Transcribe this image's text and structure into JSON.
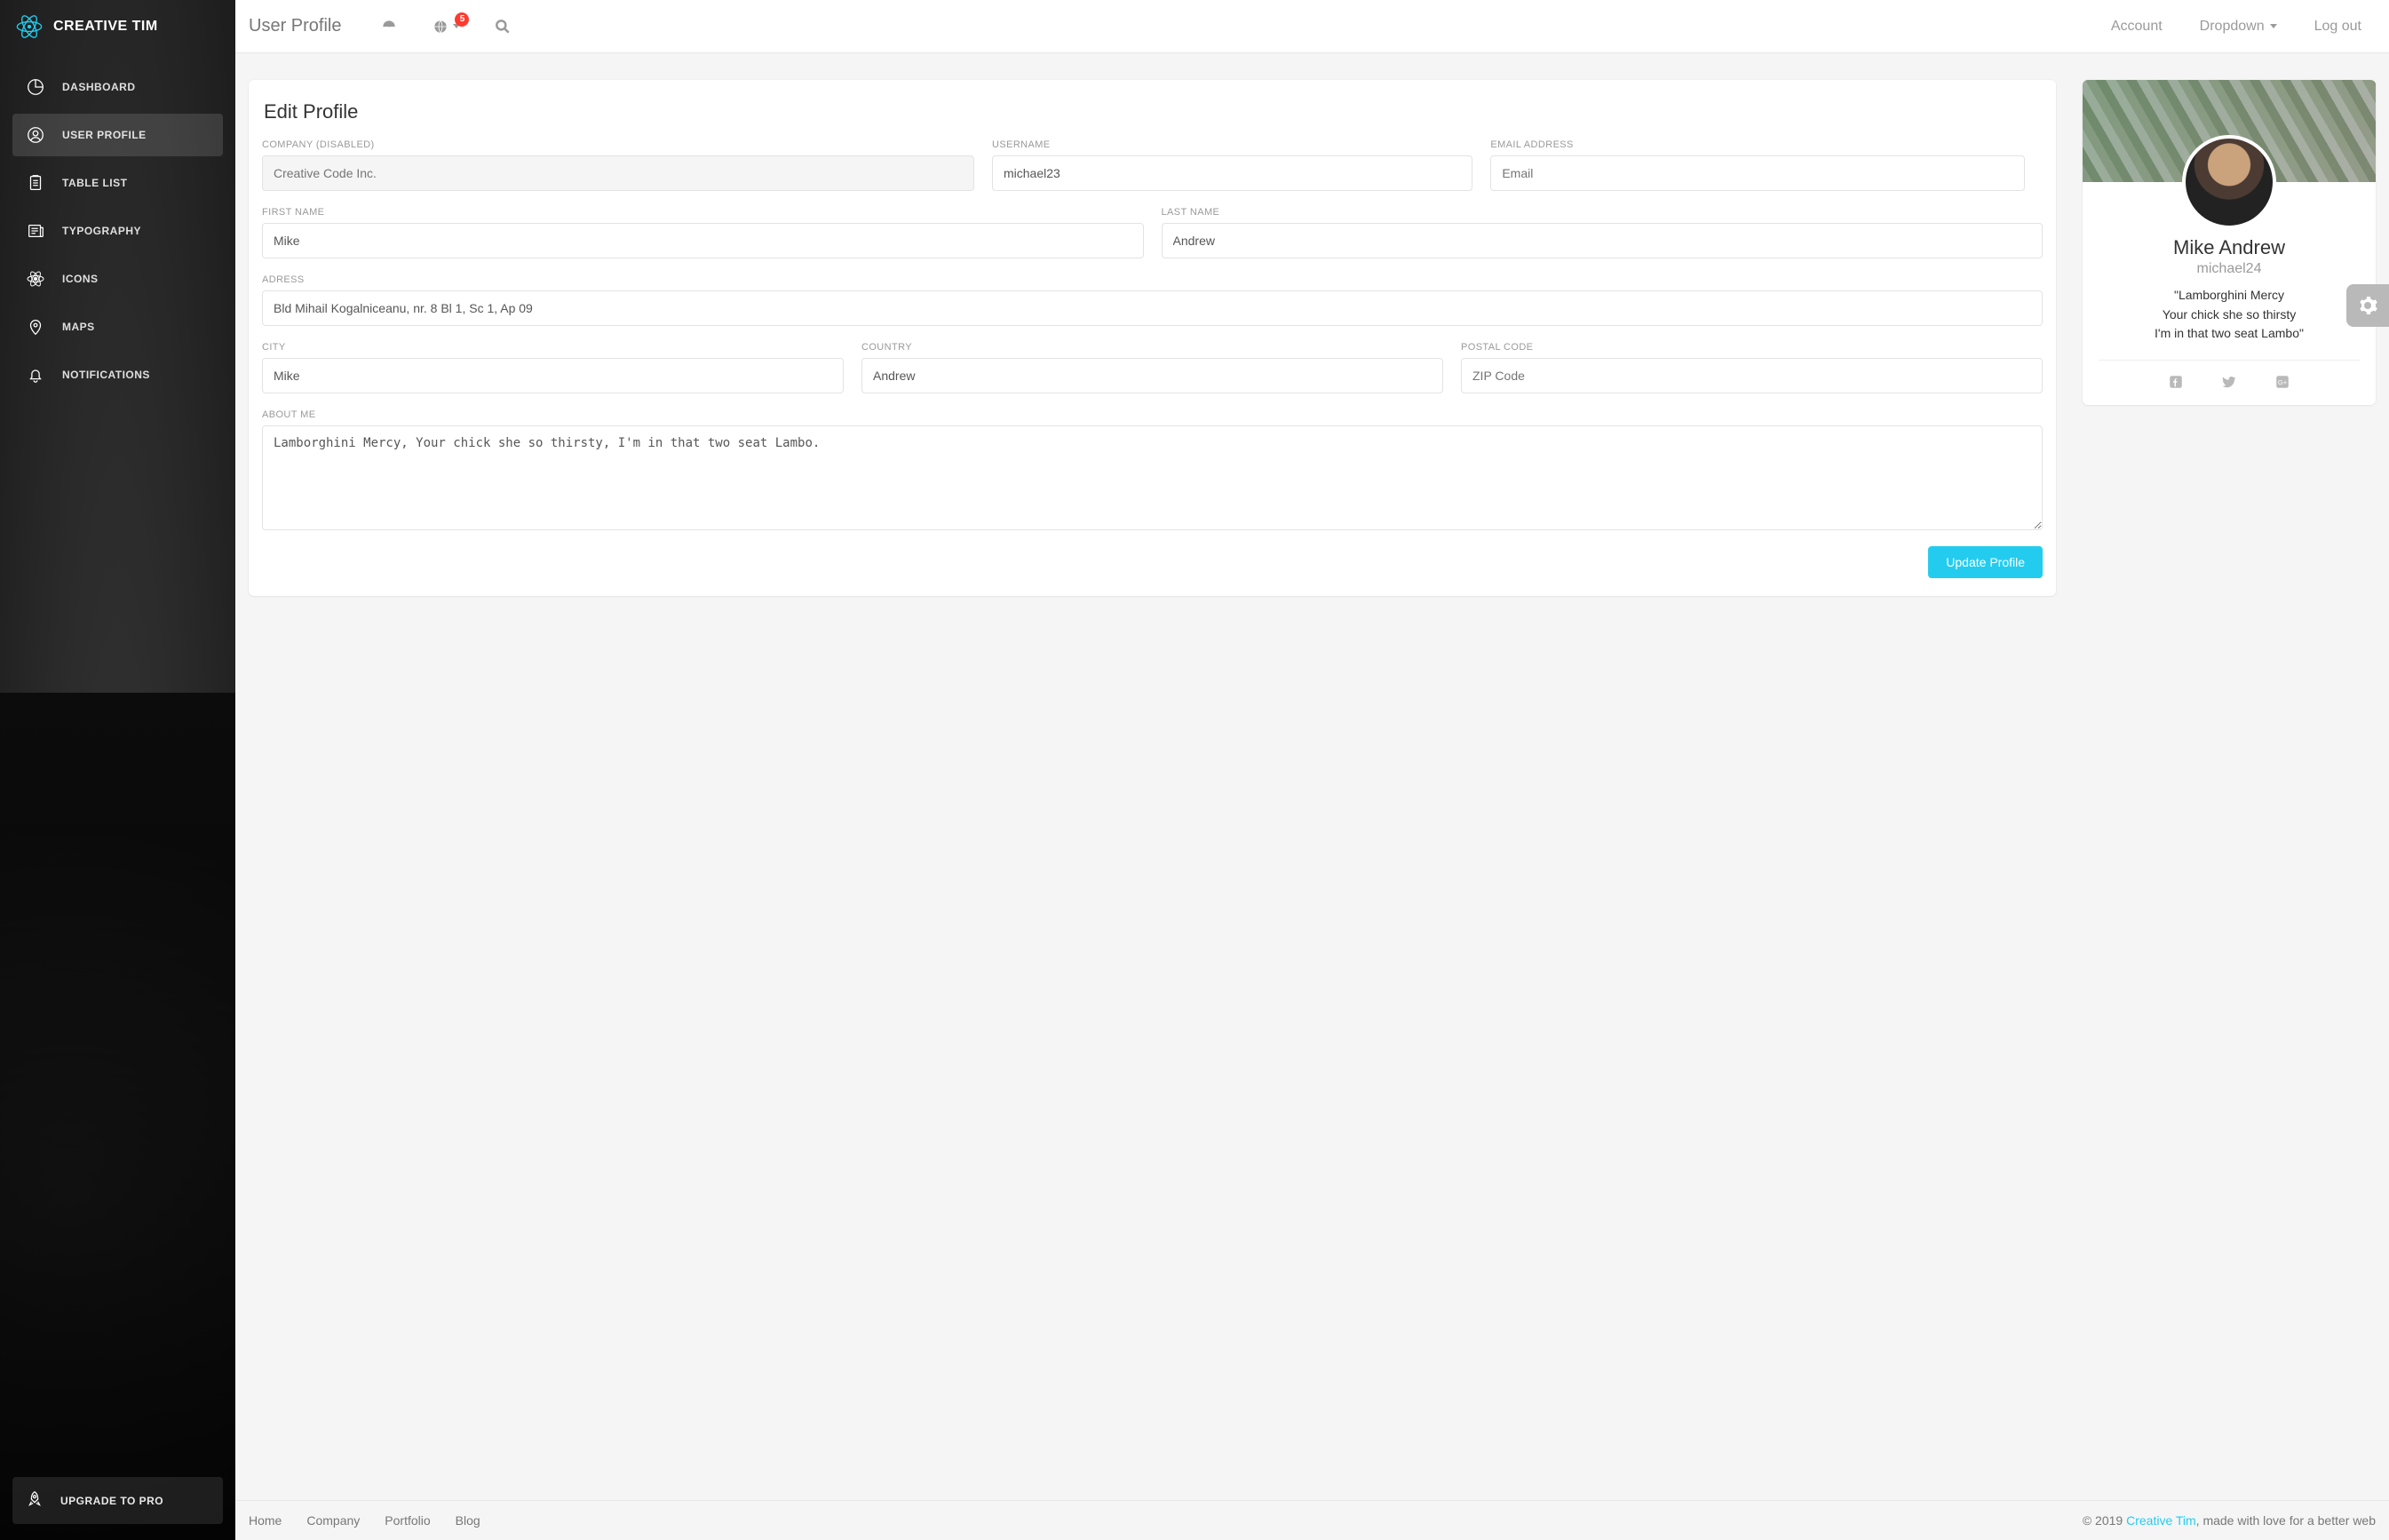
{
  "brand": "CREATIVE TIM",
  "page_title": "User Profile",
  "notifications_count": "5",
  "topnav": {
    "account": "Account",
    "dropdown": "Dropdown",
    "logout": "Log out"
  },
  "sidebar": {
    "items": [
      {
        "id": "dashboard",
        "label": "DASHBOARD",
        "icon": "dashboard"
      },
      {
        "id": "user-profile",
        "label": "USER PROFILE",
        "icon": "user",
        "active": true
      },
      {
        "id": "table-list",
        "label": "TABLE LIST",
        "icon": "table"
      },
      {
        "id": "typography",
        "label": "TYPOGRAPHY",
        "icon": "typography"
      },
      {
        "id": "icons",
        "label": "ICONS",
        "icon": "atom"
      },
      {
        "id": "maps",
        "label": "MAPS",
        "icon": "map-pin"
      },
      {
        "id": "notifications",
        "label": "NOTIFICATIONS",
        "icon": "bell"
      }
    ],
    "upgrade": "UPGRADE TO PRO"
  },
  "edit_profile": {
    "title": "Edit Profile",
    "company_label": "COMPANY (DISABLED)",
    "company_placeholder": "Creative Code Inc.",
    "username_label": "USERNAME",
    "username_value": "michael23",
    "email_label": "EMAIL ADDRESS",
    "email_placeholder": "Email",
    "first_name_label": "FIRST NAME",
    "first_name_value": "Mike",
    "last_name_label": "LAST NAME",
    "last_name_value": "Andrew",
    "address_label": "ADRESS",
    "address_value": "Bld Mihail Kogalniceanu, nr. 8 Bl 1, Sc 1, Ap 09",
    "city_label": "CITY",
    "city_value": "Mike",
    "country_label": "COUNTRY",
    "country_value": "Andrew",
    "postal_label": "POSTAL CODE",
    "postal_placeholder": "ZIP Code",
    "about_label": "ABOUT ME",
    "about_value": "Lamborghini Mercy, Your chick she so thirsty, I'm in that two seat Lambo.",
    "submit": "Update Profile"
  },
  "user_card": {
    "name": "Mike Andrew",
    "handle": "michael24",
    "quote_l1": "\"Lamborghini Mercy",
    "quote_l2": "Your chick she so thirsty",
    "quote_l3": "I'm in that two seat Lambo\""
  },
  "footer": {
    "links": [
      "Home",
      "Company",
      "Portfolio",
      "Blog"
    ],
    "copyright_prefix": "© 2019 ",
    "brand": "Creative Tim",
    "copyright_suffix": ", made with love for a better web"
  },
  "colors": {
    "accent": "#23ccef",
    "danger": "#ff3b30"
  }
}
